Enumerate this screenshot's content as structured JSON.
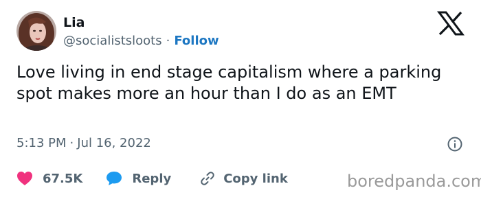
{
  "author": {
    "name": "Lia",
    "handle": "@socialistsloots",
    "separator": "·",
    "follow_label": "Follow"
  },
  "tweet": {
    "text": "Love living in end stage capitalism where a parking spot makes more an hour than I do as an EMT",
    "time": "5:13 PM",
    "separator": "·",
    "date": "Jul 16, 2022"
  },
  "actions": {
    "likes": "67.5K",
    "reply_label": "Reply",
    "copy_label": "Copy link"
  },
  "watermark": "boredpanda.com",
  "colors": {
    "text": "#0f1419",
    "secondary": "#536471",
    "follow": "#1d77c2",
    "heart": "#f0327e",
    "reply_bubble": "#1d9bf0",
    "watermark": "#9a9a9a"
  },
  "icons": {
    "platform": "x-logo-icon",
    "info": "info-icon",
    "like": "heart-icon",
    "reply": "speech-bubble-icon",
    "copy": "link-icon"
  }
}
